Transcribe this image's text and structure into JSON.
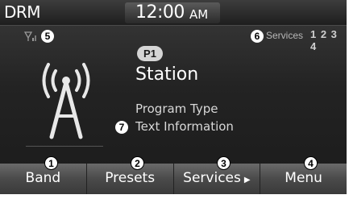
{
  "status_bar": {
    "mode": "DRM",
    "time": "12:00",
    "ampm": "AM"
  },
  "signal": {
    "callout": "5"
  },
  "services": {
    "callout": "6",
    "label": "Services",
    "numbers": "1 2 3 4"
  },
  "station": {
    "preset": "P1",
    "name": "Station",
    "program_type": "Program Type",
    "text_info": "Text Information",
    "text_callout": "7"
  },
  "softkeys": [
    {
      "label": "Band",
      "callout": "1"
    },
    {
      "label": "Presets",
      "callout": "2"
    },
    {
      "label": "Services",
      "callout": "3",
      "arrow": "▶"
    },
    {
      "label": "Menu",
      "callout": "4"
    }
  ],
  "colors": {
    "background": "#1e1e1e",
    "softkey": "#4a4a4a",
    "text": "#ffffff",
    "preset_pill": "#d5d5d5"
  }
}
